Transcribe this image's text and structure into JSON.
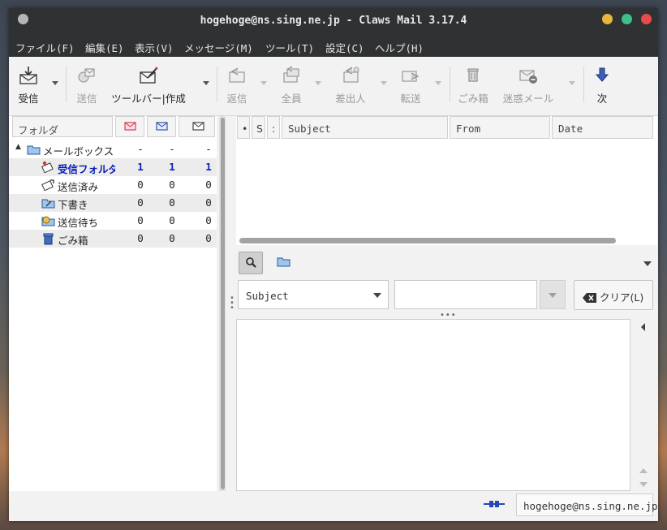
{
  "window": {
    "title": "hogehoge@ns.sing.ne.jp - Claws Mail 3.17.4"
  },
  "menu": [
    "ファイル(F)",
    "編集(E)",
    "表示(V)",
    "メッセージ(M)",
    "ツール(T)",
    "設定(C)",
    "ヘルプ(H)"
  ],
  "toolbar": {
    "receive": "受信",
    "send": "送信",
    "compose": "ツールバー|作成",
    "reply": "返信",
    "reply_all": "全員",
    "reply_sender": "差出人",
    "forward": "転送",
    "trash": "ごみ箱",
    "spam": "迷惑メール",
    "next": "次"
  },
  "folder_pane": {
    "header_label": "フォルダ",
    "folders": [
      {
        "name": "メールボックス",
        "new": "-",
        "unread": "-",
        "total": "-",
        "icon": "mailbox-icon"
      },
      {
        "name": "受信フォルダ",
        "new": "1",
        "unread": "1",
        "total": "1",
        "icon": "inbox-icon",
        "bold": true
      },
      {
        "name": "送信済み",
        "new": "0",
        "unread": "0",
        "total": "0",
        "icon": "sent-icon"
      },
      {
        "name": "下書き",
        "new": "0",
        "unread": "0",
        "total": "0",
        "icon": "drafts-icon"
      },
      {
        "name": "送信待ち",
        "new": "0",
        "unread": "0",
        "total": "0",
        "icon": "queue-icon"
      },
      {
        "name": "ごみ箱",
        "new": "0",
        "unread": "0",
        "total": "0",
        "icon": "trash-icon"
      }
    ]
  },
  "message_list": {
    "columns": {
      "mark": "•",
      "status": "S",
      "attach": ":",
      "subject": "Subject",
      "from": "From",
      "date": "Date"
    }
  },
  "search": {
    "field_value": "Subject",
    "query_value": "",
    "clear_label": "クリア(L)"
  },
  "statusbar": {
    "account": "hogehoge@ns.sing.ne.jp"
  },
  "colors": {
    "titlebar": "#2f3132",
    "unread_blue": "#0a1fb5",
    "close": "#e94b4b",
    "maximize": "#3fbf8e",
    "minimize": "#e7b63b"
  }
}
